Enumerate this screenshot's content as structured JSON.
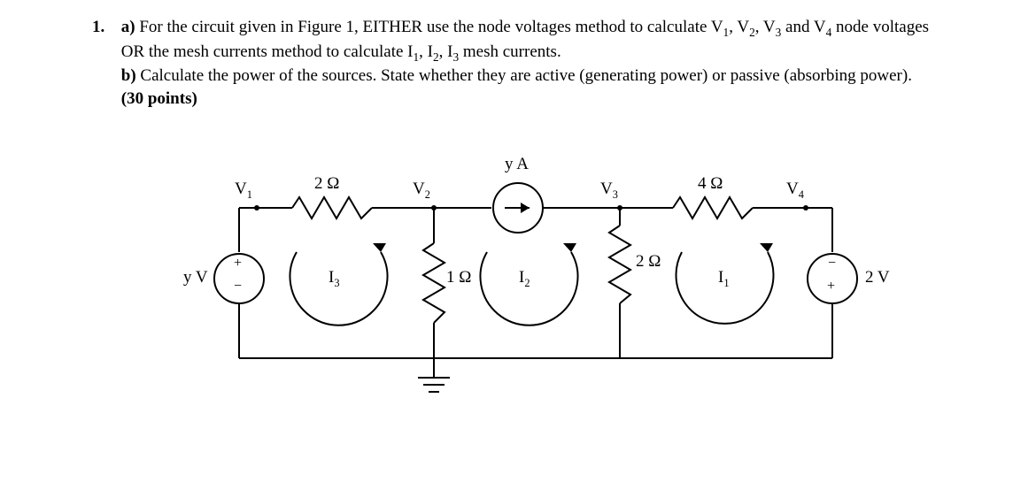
{
  "question": {
    "number": "1.",
    "partA_label": "a)",
    "partA_text": "For the circuit given in Figure 1, EITHER use the node voltages method to calculate V",
    "partA_text2": ", V",
    "partA_text3": ", V",
    "partA_text4": " and V",
    "partA_text5": " node voltages OR the mesh currents method to calculate I",
    "partA_text6": ", I",
    "partA_text7": ", I",
    "partA_text8": " mesh currents.",
    "partB_label": "b)",
    "partB_text": " Calculate the power of the sources. State whether they are active (generating power) or passive (absorbing power). ",
    "points": "(30 points)"
  },
  "circuit": {
    "node_V1": "V",
    "node_V2": "V",
    "node_V3": "V",
    "node_V4": "V",
    "R1_label": "2 Ω",
    "R2_label": "1 Ω",
    "R3_label": "2 Ω",
    "R4_label": "4 Ω",
    "Isrc_label": "y A",
    "Vsrc_left": "y V",
    "Vsrc_right": "2 V",
    "mesh_I1": "I",
    "mesh_I2": "I",
    "mesh_I3": "I",
    "sub1": "1",
    "sub2": "2",
    "sub3": "3",
    "sub4": "4",
    "plus": "+",
    "minus": "−"
  }
}
